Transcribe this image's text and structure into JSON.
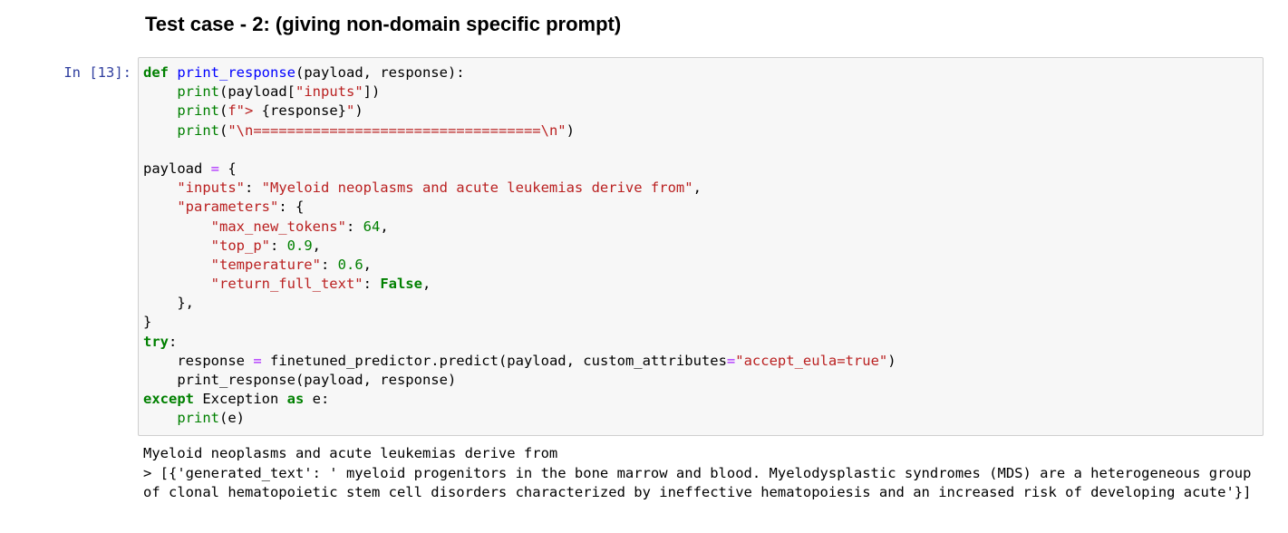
{
  "heading": "Test case - 2: (giving non-domain specific prompt)",
  "cell": {
    "prompt": "In [13]:",
    "code_lines": [
      [
        {
          "t": "def",
          "c": "kw"
        },
        {
          "t": " "
        },
        {
          "t": "print_response",
          "c": "fn"
        },
        {
          "t": "(payload, response):"
        }
      ],
      [
        {
          "t": "    "
        },
        {
          "t": "print",
          "c": "bi"
        },
        {
          "t": "(payload["
        },
        {
          "t": "\"inputs\"",
          "c": "st"
        },
        {
          "t": "])"
        }
      ],
      [
        {
          "t": "    "
        },
        {
          "t": "print",
          "c": "bi"
        },
        {
          "t": "("
        },
        {
          "t": "f\"> ",
          "c": "st"
        },
        {
          "t": "{response}"
        },
        {
          "t": "\"",
          "c": "st"
        },
        {
          "t": ")"
        }
      ],
      [
        {
          "t": "    "
        },
        {
          "t": "print",
          "c": "bi"
        },
        {
          "t": "("
        },
        {
          "t": "\"\\n==================================\\n\"",
          "c": "st"
        },
        {
          "t": ")"
        }
      ],
      [
        {
          "t": ""
        }
      ],
      [
        {
          "t": "payload "
        },
        {
          "t": "=",
          "c": "op"
        },
        {
          "t": " {"
        }
      ],
      [
        {
          "t": "    "
        },
        {
          "t": "\"inputs\"",
          "c": "st"
        },
        {
          "t": ": "
        },
        {
          "t": "\"Myeloid neoplasms and acute leukemias derive from\"",
          "c": "st"
        },
        {
          "t": ","
        }
      ],
      [
        {
          "t": "    "
        },
        {
          "t": "\"parameters\"",
          "c": "st"
        },
        {
          "t": ": {"
        }
      ],
      [
        {
          "t": "        "
        },
        {
          "t": "\"max_new_tokens\"",
          "c": "st"
        },
        {
          "t": ": "
        },
        {
          "t": "64",
          "c": "nu"
        },
        {
          "t": ","
        }
      ],
      [
        {
          "t": "        "
        },
        {
          "t": "\"top_p\"",
          "c": "st"
        },
        {
          "t": ": "
        },
        {
          "t": "0.9",
          "c": "nu"
        },
        {
          "t": ","
        }
      ],
      [
        {
          "t": "        "
        },
        {
          "t": "\"temperature\"",
          "c": "st"
        },
        {
          "t": ": "
        },
        {
          "t": "0.6",
          "c": "nu"
        },
        {
          "t": ","
        }
      ],
      [
        {
          "t": "        "
        },
        {
          "t": "\"return_full_text\"",
          "c": "st"
        },
        {
          "t": ": "
        },
        {
          "t": "False",
          "c": "kw"
        },
        {
          "t": ","
        }
      ],
      [
        {
          "t": "    },"
        }
      ],
      [
        {
          "t": "}"
        }
      ],
      [
        {
          "t": "try",
          "c": "kw"
        },
        {
          "t": ":"
        }
      ],
      [
        {
          "t": "    response "
        },
        {
          "t": "=",
          "c": "op"
        },
        {
          "t": " finetuned_predictor.predict(payload, custom_attributes"
        },
        {
          "t": "=",
          "c": "op"
        },
        {
          "t": "\"accept_eula=true\"",
          "c": "st"
        },
        {
          "t": ")"
        }
      ],
      [
        {
          "t": "    print_response(payload, response)"
        }
      ],
      [
        {
          "t": "except",
          "c": "kw"
        },
        {
          "t": " Exception "
        },
        {
          "t": "as",
          "c": "kw"
        },
        {
          "t": " e:"
        }
      ],
      [
        {
          "t": "    "
        },
        {
          "t": "print",
          "c": "bi"
        },
        {
          "t": "(e)"
        }
      ]
    ],
    "output_lines": [
      "Myeloid neoplasms and acute leukemias derive from",
      "> [{'generated_text': ' myeloid progenitors in the bone marrow and blood. Myelodysplastic syndromes (MDS) are a heterogeneous group of clonal hematopoietic stem cell disorders characterized by ineffective hematopoiesis and an increased risk of developing acute'}]"
    ]
  },
  "colors": {
    "prompt": "#303f9f",
    "keyword": "#008000",
    "string": "#ba2121",
    "function": "#0000ff",
    "operator": "#aa22ff",
    "cell_background": "#f7f7f7",
    "cell_border": "#cfcfcf"
  }
}
